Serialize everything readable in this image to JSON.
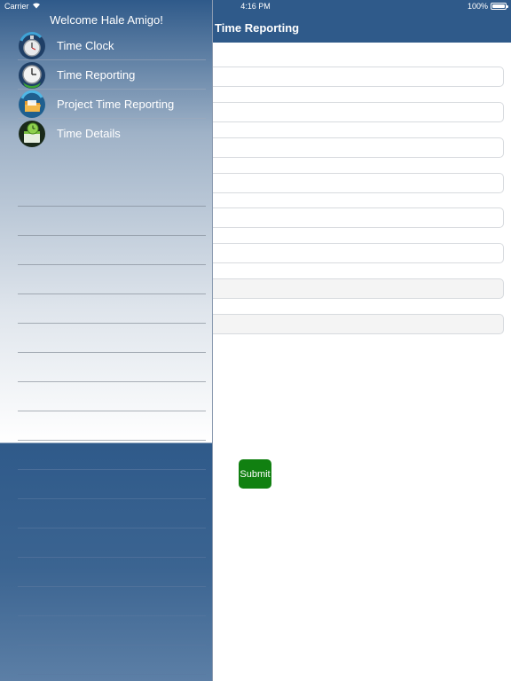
{
  "status_bar": {
    "carrier": "Carrier",
    "time": "4:16 PM",
    "battery": "100%"
  },
  "nav": {
    "title": "Time Reporting"
  },
  "side_menu": {
    "welcome": "Welcome Hale Amigo!",
    "items": [
      {
        "label": "Time Clock",
        "icon": "stopwatch-icon"
      },
      {
        "label": "Time Reporting",
        "icon": "clock-icon"
      },
      {
        "label": "Project Time Reporting",
        "icon": "folder-icon"
      },
      {
        "label": "Time Details",
        "icon": "calendar-clock-icon"
      }
    ]
  },
  "form": {
    "submit_label": "Submit"
  },
  "colors": {
    "nav_blue": "#2f5a8a",
    "submit_green": "#118011"
  }
}
